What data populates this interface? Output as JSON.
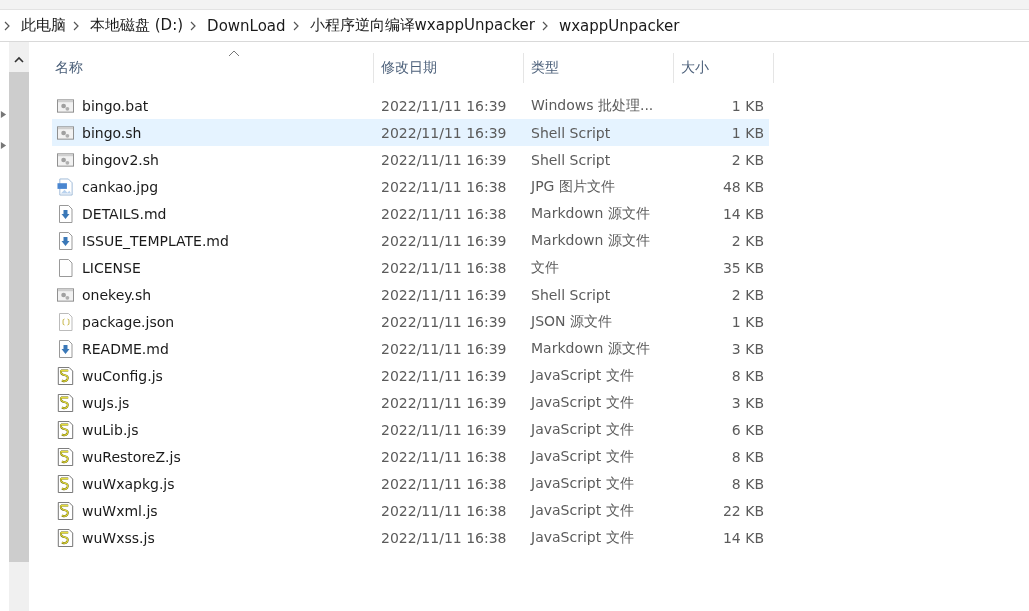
{
  "breadcrumb": [
    "此电脑",
    "本地磁盘 (D:)",
    "DownLoad",
    "小程序逆向编译wxappUnpacker",
    "wxappUnpacker"
  ],
  "columns": [
    "名称",
    "修改日期",
    "类型",
    "大小"
  ],
  "rows": [
    {
      "kind": "script",
      "name": "bingo.bat",
      "date": "2022/11/11 16:39",
      "type": "Windows 批处理...",
      "size": "1 KB",
      "selected": false
    },
    {
      "kind": "script",
      "name": "bingo.sh",
      "date": "2022/11/11 16:39",
      "type": "Shell Script",
      "size": "1 KB",
      "selected": true
    },
    {
      "kind": "script",
      "name": "bingov2.sh",
      "date": "2022/11/11 16:39",
      "type": "Shell Script",
      "size": "2 KB",
      "selected": false
    },
    {
      "kind": "image",
      "name": "cankao.jpg",
      "date": "2022/11/11 16:38",
      "type": "JPG 图片文件",
      "size": "48 KB",
      "selected": false
    },
    {
      "kind": "markdown",
      "name": "DETAILS.md",
      "date": "2022/11/11 16:38",
      "type": "Markdown 源文件",
      "size": "14 KB",
      "selected": false
    },
    {
      "kind": "markdown",
      "name": "ISSUE_TEMPLATE.md",
      "date": "2022/11/11 16:39",
      "type": "Markdown 源文件",
      "size": "2 KB",
      "selected": false
    },
    {
      "kind": "blank",
      "name": "LICENSE",
      "date": "2022/11/11 16:38",
      "type": "文件",
      "size": "35 KB",
      "selected": false
    },
    {
      "kind": "script",
      "name": "onekey.sh",
      "date": "2022/11/11 16:39",
      "type": "Shell Script",
      "size": "2 KB",
      "selected": false
    },
    {
      "kind": "json",
      "name": "package.json",
      "date": "2022/11/11 16:39",
      "type": "JSON 源文件",
      "size": "1 KB",
      "selected": false
    },
    {
      "kind": "markdown",
      "name": "README.md",
      "date": "2022/11/11 16:39",
      "type": "Markdown 源文件",
      "size": "3 KB",
      "selected": false
    },
    {
      "kind": "js",
      "name": "wuConfig.js",
      "date": "2022/11/11 16:39",
      "type": "JavaScript 文件",
      "size": "8 KB",
      "selected": false
    },
    {
      "kind": "js",
      "name": "wuJs.js",
      "date": "2022/11/11 16:39",
      "type": "JavaScript 文件",
      "size": "3 KB",
      "selected": false
    },
    {
      "kind": "js",
      "name": "wuLib.js",
      "date": "2022/11/11 16:39",
      "type": "JavaScript 文件",
      "size": "6 KB",
      "selected": false
    },
    {
      "kind": "js",
      "name": "wuRestoreZ.js",
      "date": "2022/11/11 16:38",
      "type": "JavaScript 文件",
      "size": "8 KB",
      "selected": false
    },
    {
      "kind": "js",
      "name": "wuWxapkg.js",
      "date": "2022/11/11 16:38",
      "type": "JavaScript 文件",
      "size": "8 KB",
      "selected": false
    },
    {
      "kind": "js",
      "name": "wuWxml.js",
      "date": "2022/11/11 16:38",
      "type": "JavaScript 文件",
      "size": "22 KB",
      "selected": false
    },
    {
      "kind": "js",
      "name": "wuWxss.js",
      "date": "2022/11/11 16:38",
      "type": "JavaScript 文件",
      "size": "14 KB",
      "selected": false
    }
  ]
}
